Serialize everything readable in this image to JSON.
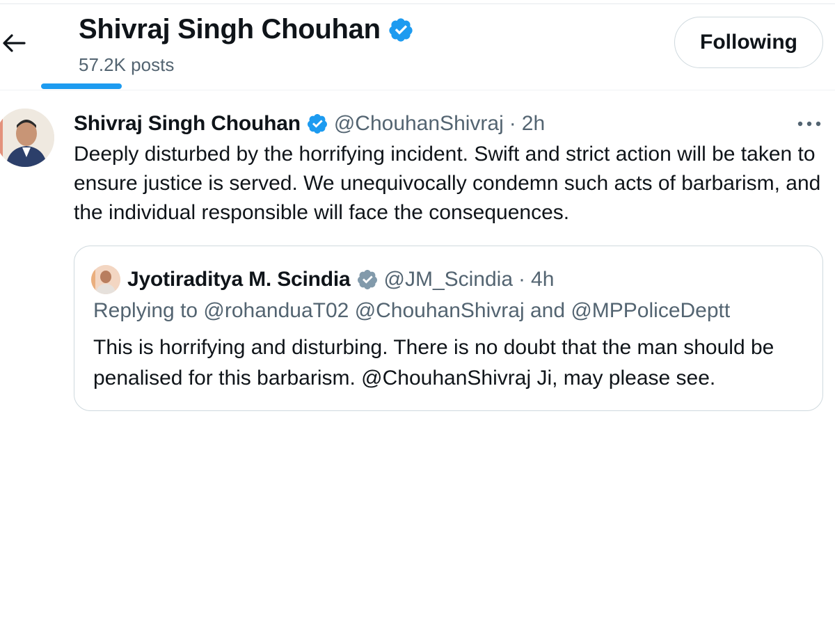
{
  "header": {
    "title": "Shivraj Singh Chouhan",
    "posts_count": "57.2K posts",
    "follow_label": "Following"
  },
  "tweet": {
    "author_name": "Shivraj Singh Chouhan",
    "handle": "@ChouhanShivraj",
    "separator": "·",
    "time": "2h",
    "text": "Deeply disturbed by the horrifying incident. Swift and strict action will be taken to ensure justice is served. We unequivocally condemn such acts of barbarism, and the individual responsible will face the consequences."
  },
  "quote": {
    "author_name": "Jyotiraditya M. Scindia",
    "handle": "@JM_Scindia",
    "separator": "·",
    "time": "4h",
    "replying_to": "Replying to @rohanduaT02 @ChouhanShivraj and @MPPoliceDeptt",
    "text": "This is horrifying and disturbing. There is no doubt that the man should be penalised for this barbarism. @ChouhanShivraj Ji, may please see."
  },
  "colors": {
    "accent": "#1d9bf0",
    "verified_blue": "#1d9bf0",
    "verified_gray": "#829aab",
    "muted_text": "#536471",
    "border": "#cfd9de"
  },
  "icons": {
    "back": "arrow-left-icon",
    "verified": "verified-badge-icon",
    "more": "more-dots-icon"
  }
}
